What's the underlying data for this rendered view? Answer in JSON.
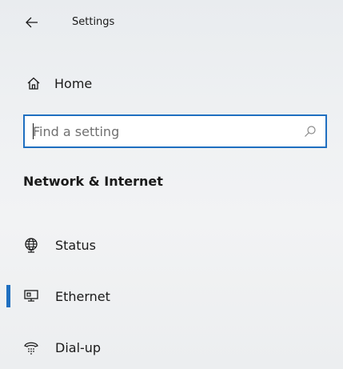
{
  "header": {
    "title": "Settings"
  },
  "home": {
    "label": "Home"
  },
  "search": {
    "placeholder": "Find a setting",
    "value": ""
  },
  "section": {
    "title": "Network & Internet"
  },
  "nav": {
    "items": [
      {
        "label": "Status",
        "icon": "globe-icon",
        "selected": false
      },
      {
        "label": "Ethernet",
        "icon": "ethernet-icon",
        "selected": true
      },
      {
        "label": "Dial-up",
        "icon": "dial-up-icon",
        "selected": false
      }
    ]
  },
  "colors": {
    "accent": "#1f6fc0",
    "text": "#1a1a1a",
    "placeholder": "#707070"
  }
}
